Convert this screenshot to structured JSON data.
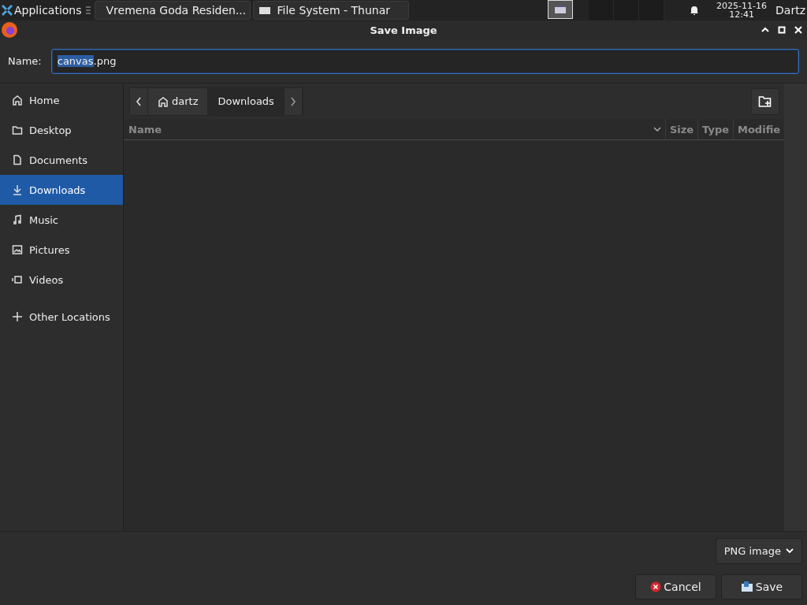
{
  "taskbar": {
    "menu_label": "Applications",
    "tasks": [
      {
        "label": "Vremena Goda Residen...",
        "selected": false
      },
      {
        "label": "File System - Thunar",
        "selected": false
      }
    ],
    "workspaces": [
      {
        "selected": true
      },
      {
        "selected": false
      },
      {
        "selected": false
      },
      {
        "selected": false
      }
    ],
    "clock": {
      "date": "2025-11-16",
      "time": "12:41"
    },
    "user": "Dartz"
  },
  "window": {
    "title": "Save Image"
  },
  "name_field": {
    "label": "Name:",
    "selected_part": "canvas",
    "unselected_part": ".png"
  },
  "sidebar": {
    "items": [
      {
        "label": "Home",
        "kind": "place",
        "selected": false
      },
      {
        "label": "Desktop",
        "kind": "place",
        "selected": false
      },
      {
        "label": "Documents",
        "kind": "place",
        "selected": false
      },
      {
        "label": "Downloads",
        "kind": "place",
        "selected": true
      },
      {
        "label": "Music",
        "kind": "place",
        "selected": false
      },
      {
        "label": "Pictures",
        "kind": "place",
        "selected": false
      },
      {
        "label": "Videos",
        "kind": "place",
        "selected": false
      },
      {
        "label": "Other Locations",
        "kind": "other",
        "selected": false
      }
    ]
  },
  "path_bar": {
    "segments": [
      {
        "label": "dartz",
        "kind": "home",
        "selected": false
      },
      {
        "label": "Downloads",
        "kind": "folder",
        "selected": true
      }
    ]
  },
  "table": {
    "columns": [
      "Name",
      "Size",
      "Type",
      "Modifie"
    ]
  },
  "file_type": "PNG image",
  "buttons": [
    {
      "label": "Cancel",
      "kind": "cancel"
    },
    {
      "label": "Save",
      "kind": "save"
    }
  ]
}
